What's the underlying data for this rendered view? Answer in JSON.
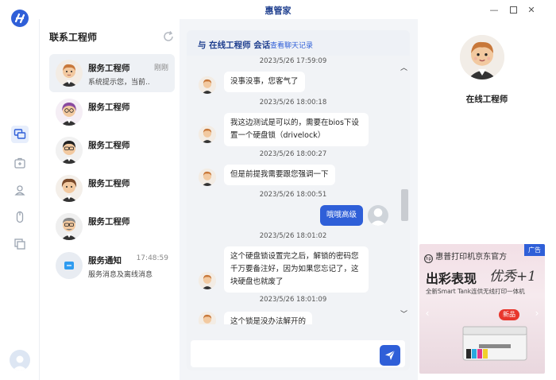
{
  "window": {
    "title": "惠管家"
  },
  "contacts": {
    "header": "联系工程师",
    "items": [
      {
        "name": "服务工程师",
        "preview": "系统提示您，当前...",
        "time": "刚刚",
        "active": true
      },
      {
        "name": "服务工程师",
        "preview": "",
        "time": ""
      },
      {
        "name": "服务工程师",
        "preview": "",
        "time": ""
      },
      {
        "name": "服务工程师",
        "preview": "",
        "time": ""
      },
      {
        "name": "服务工程师",
        "preview": "",
        "time": ""
      }
    ],
    "notice": {
      "name": "服务通知",
      "preview": "服务消息及离线消息",
      "time": "17:48:59"
    }
  },
  "chat": {
    "title": "与 在线工程师 会话",
    "history_link": "查看聊天记录",
    "messages": [
      {
        "timestamp": "2023/5/26 17:59:09",
        "text": "没事没事，您客气了",
        "from": "engineer"
      },
      {
        "timestamp": "2023/5/26 18:00:18",
        "text": "我这边测试是可以的，需要在bios下设置一个硬盘锁（drivelock）",
        "from": "engineer"
      },
      {
        "timestamp": "2023/5/26 18:00:27",
        "text": "但是前提我需要跟您强调一下",
        "from": "engineer"
      },
      {
        "timestamp": "2023/5/26 18:00:51",
        "text": "哦哦高级",
        "from": "user"
      },
      {
        "timestamp": "2023/5/26 18:01:02",
        "text": "这个硬盘锁设置完之后，解锁的密码您千万要备注好，因为如果您忘记了，这块硬盘也就废了",
        "from": "engineer"
      },
      {
        "timestamp": "2023/5/26 18:01:09",
        "text": "这个锁是没办法解开的",
        "from": "engineer"
      }
    ],
    "input_placeholder": ""
  },
  "engineer": {
    "name": "在线工程师"
  },
  "ad": {
    "badge": "广告",
    "brand": "惠普打印机京东官方",
    "slogan": "出彩表现",
    "script": "优秀+1",
    "sub": "全新Smart Tank连供无线打印一体机",
    "new_tag": "新品"
  },
  "colors": {
    "accent": "#2f5fd8",
    "title": "#1f3f8f"
  }
}
